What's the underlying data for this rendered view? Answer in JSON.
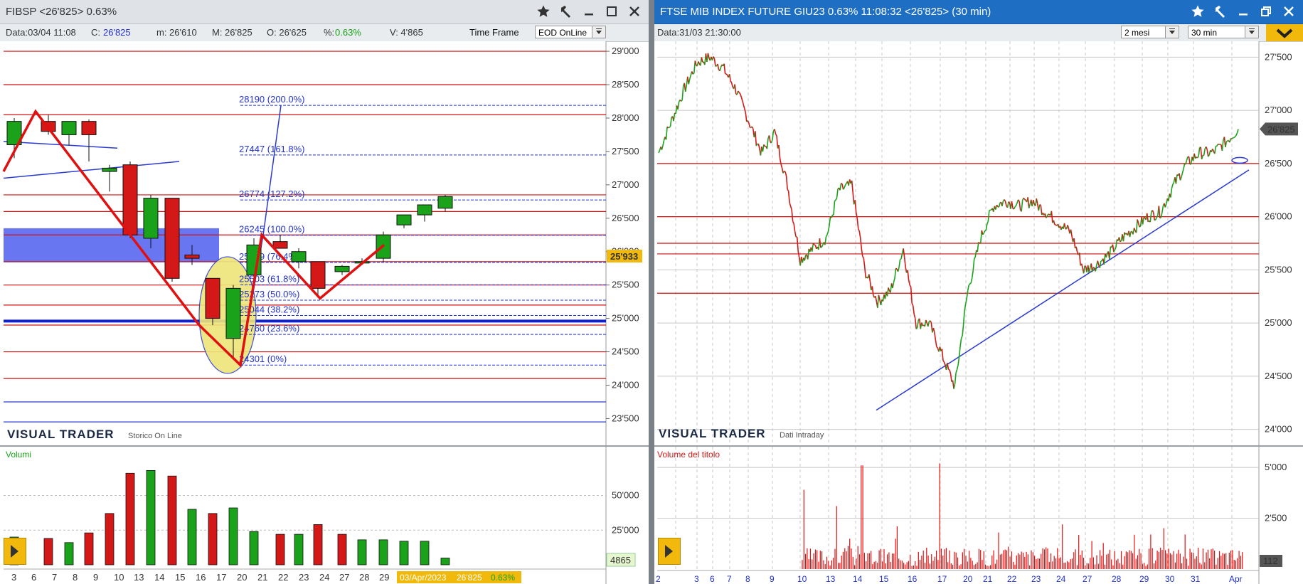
{
  "left": {
    "title": "FIBSP  <26'825>  0.63%",
    "info": {
      "data": "Data:03/04 11:08",
      "c_label": "C:",
      "c_value": "26'825",
      "m": "m: 26'610",
      "M": "M: 26'825",
      "O": "O: 26'625",
      "pct_label": "%:",
      "pct_value": "0.63%",
      "V": "V: 4'865",
      "timeframe_label": "Time Frame",
      "timeframe_value": "EOD OnLine"
    },
    "brand": "VISUAL TRADER",
    "brand_sub": "Storico On Line",
    "volume_title": "Volumi",
    "last_price_badge": "25'933",
    "last_volume_badge": "4865",
    "date_badge_date": "03/Apr/2023",
    "date_badge_price": "26'825",
    "date_badge_pct": "0.63%"
  },
  "right": {
    "title": "FTSE MIB INDEX FUTURE GIU23 0.63% 11:08:32  <26'825> (30 min)",
    "info": {
      "data": "Data:31/03 21:30:00",
      "period_value": "2 mesi",
      "interval_value": "30 min"
    },
    "brand": "VISUAL TRADER",
    "brand_sub": "Dati Intraday",
    "volume_title": "Volume del titolo",
    "last_price_badge": "26'825",
    "last_volume_badge": "112"
  },
  "colors": {
    "up": "#1aa31a",
    "down": "#d41818",
    "fib": "#2233cc",
    "red_line": "#cc1111",
    "blue_zone": "#4d5ef0",
    "highlight": "#eee57a",
    "badge": "#f0b90c",
    "title_dark": "#1e6fc4"
  },
  "chart_data": [
    {
      "type": "candlestick",
      "name": "left-price",
      "ylim": [
        23100,
        29150
      ],
      "y_ticks": [
        23500,
        24000,
        24500,
        25000,
        25500,
        26000,
        26500,
        27000,
        27500,
        28000,
        28500,
        29000
      ],
      "y_tick_labels": [
        "23'500",
        "24'000",
        "24'500",
        "25'000",
        "25'500",
        "26'000",
        "26'500",
        "27'000",
        "27'500",
        "28'000",
        "28'500",
        "29'000"
      ],
      "x_labels": [
        "3",
        "6",
        "7",
        "8",
        "9",
        "10",
        "13",
        "14",
        "15",
        "16",
        "17",
        "20",
        "21",
        "22",
        "23",
        "24",
        "27",
        "28",
        "29"
      ],
      "candles": [
        {
          "o": 27600,
          "h": 28000,
          "l": 27400,
          "c": 27950
        },
        {
          "o": 27950,
          "h": 28050,
          "l": 27750,
          "c": 27800
        },
        {
          "o": 27750,
          "h": 27950,
          "l": 27600,
          "c": 27950
        },
        {
          "o": 27950,
          "h": 27980,
          "l": 27350,
          "c": 27750
        },
        {
          "o": 27200,
          "h": 27300,
          "l": 26900,
          "c": 27250
        },
        {
          "o": 27300,
          "h": 27350,
          "l": 26200,
          "c": 26250
        },
        {
          "o": 26200,
          "h": 26850,
          "l": 26050,
          "c": 26800
        },
        {
          "o": 26800,
          "h": 26800,
          "l": 25550,
          "c": 25600
        },
        {
          "o": 25950,
          "h": 26100,
          "l": 25800,
          "c": 25900
        },
        {
          "o": 25600,
          "h": 25600,
          "l": 24900,
          "c": 25000
        },
        {
          "o": 24700,
          "h": 25500,
          "l": 24400,
          "c": 25450
        },
        {
          "o": 25650,
          "h": 26200,
          "l": 25500,
          "c": 26100
        },
        {
          "o": 26150,
          "h": 26250,
          "l": 26050,
          "c": 26050
        },
        {
          "o": 25850,
          "h": 26050,
          "l": 25750,
          "c": 26000
        },
        {
          "o": 25850,
          "h": 25850,
          "l": 25350,
          "c": 25450
        },
        {
          "o": 25700,
          "h": 25800,
          "l": 25650,
          "c": 25780
        },
        {
          "o": 25850,
          "h": 25900,
          "l": 25800,
          "c": 25850
        },
        {
          "o": 25900,
          "h": 26300,
          "l": 25850,
          "c": 26250
        },
        {
          "o": 26400,
          "h": 26550,
          "l": 26350,
          "c": 26550
        },
        {
          "o": 26550,
          "h": 26700,
          "l": 26450,
          "c": 26700
        },
        {
          "o": 26650,
          "h": 26850,
          "l": 26600,
          "c": 26825
        }
      ],
      "horizontal_levels": [
        29000,
        28500,
        28050,
        26850,
        26600,
        26250,
        25850,
        25500,
        25200,
        24900,
        24500,
        24100,
        23750,
        23450
      ],
      "fib_levels": [
        {
          "value": 28190,
          "label": "28190 (200.0%)"
        },
        {
          "value": 27447,
          "label": "27447 (161.8%)"
        },
        {
          "value": 26774,
          "label": "26774 (127.2%)"
        },
        {
          "value": 26245,
          "label": "26245 (100.0%)"
        },
        {
          "value": 25839,
          "label": "25839 (76.4%)"
        },
        {
          "value": 25503,
          "label": "25503 (61.8%)"
        },
        {
          "value": 25273,
          "label": "25273 (50.0%)"
        },
        {
          "value": 25044,
          "label": "25044 (38.2%)"
        },
        {
          "value": 24760,
          "label": "24760 (23.6%)"
        },
        {
          "value": 24301,
          "label": "24301 (0%)"
        }
      ],
      "support_zone": [
        25840,
        26350
      ],
      "bold_level": 24960
    },
    {
      "type": "bar",
      "name": "left-volume",
      "ylim": [
        0,
        80000
      ],
      "y_ticks": [
        25000,
        50000
      ],
      "y_tick_labels": [
        "25'000",
        "50'000"
      ],
      "values": [
        20000,
        19000,
        16000,
        23000,
        37000,
        66000,
        68000,
        64000,
        40000,
        37000,
        41000,
        24000,
        22000,
        22000,
        29000,
        22000,
        18000,
        18000,
        17000,
        17000,
        4865
      ],
      "directions": [
        "up",
        "down",
        "up",
        "down",
        "down",
        "down",
        "up",
        "down",
        "up",
        "down",
        "up",
        "up",
        "down",
        "up",
        "down",
        "down",
        "up",
        "up",
        "up",
        "up",
        "up"
      ]
    },
    {
      "type": "line",
      "name": "right-price",
      "ylim": [
        23850,
        27650
      ],
      "y_ticks": [
        24000,
        24500,
        25000,
        25500,
        26000,
        26500,
        27000,
        27500
      ],
      "y_tick_labels": [
        "24'000",
        "24'500",
        "25'000",
        "25'500",
        "26'000",
        "26'500",
        "27'000",
        "27'500"
      ],
      "x_labels": [
        "2",
        "3",
        "6",
        "7",
        "8",
        "9",
        "10",
        "13",
        "14",
        "15",
        "16",
        "17",
        "20",
        "21",
        "22",
        "23",
        "24",
        "27",
        "28",
        "29",
        "30",
        "31",
        "Apr"
      ],
      "series": [
        {
          "values": [
            26600,
            26900,
            27200,
            27450,
            27500,
            27400,
            27200,
            26900,
            26600,
            26800,
            26300,
            25600,
            25700,
            25800,
            26250,
            26300,
            25500,
            25200,
            25300,
            25700,
            25000,
            25000,
            24700,
            24400,
            25300,
            25800,
            26100,
            26150,
            26100,
            26150,
            26050,
            25950,
            25850,
            25500,
            25550,
            25650,
            25800,
            25900,
            26000,
            26050,
            26300,
            26500,
            26600,
            26600,
            26700,
            26825
          ]
        }
      ],
      "horizontal_levels": [
        26500,
        26000,
        25750,
        25650,
        25280
      ],
      "trendline": [
        [
          24650,
          24200
        ],
        [
          26450,
          26450
        ]
      ]
    },
    {
      "type": "bar",
      "name": "right-volume",
      "ylim": [
        0,
        5600
      ],
      "y_ticks": [
        2500,
        5000
      ],
      "y_tick_labels": [
        "2'500",
        "5'000"
      ],
      "peak_values": [
        5100,
        5200,
        3900,
        3100,
        2000,
        2400,
        2200,
        1800,
        1700
      ],
      "last_value": 112
    }
  ]
}
